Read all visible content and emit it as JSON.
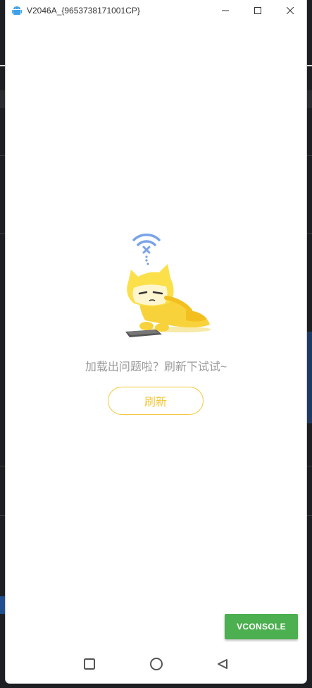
{
  "window": {
    "title": "V2046A_{9653738171001CP}",
    "app_icon": "android-icon",
    "controls": {
      "minimize_icon": "minimize-icon",
      "maximize_icon": "maximize-icon",
      "close_icon": "close-icon"
    }
  },
  "main": {
    "illustration": "offline-cat-illustration",
    "error_message": "加载出问题啦？刷新下试试~",
    "refresh_label": "刷新"
  },
  "vconsole": {
    "label": "VCONSOLE"
  },
  "navbar": {
    "items": [
      "square-nav-icon",
      "circle-home-icon",
      "triangle-back-icon"
    ]
  },
  "colors": {
    "accent": "#f3c83b",
    "vconsole": "#4caf50",
    "wifi": "#7aa3e8"
  }
}
